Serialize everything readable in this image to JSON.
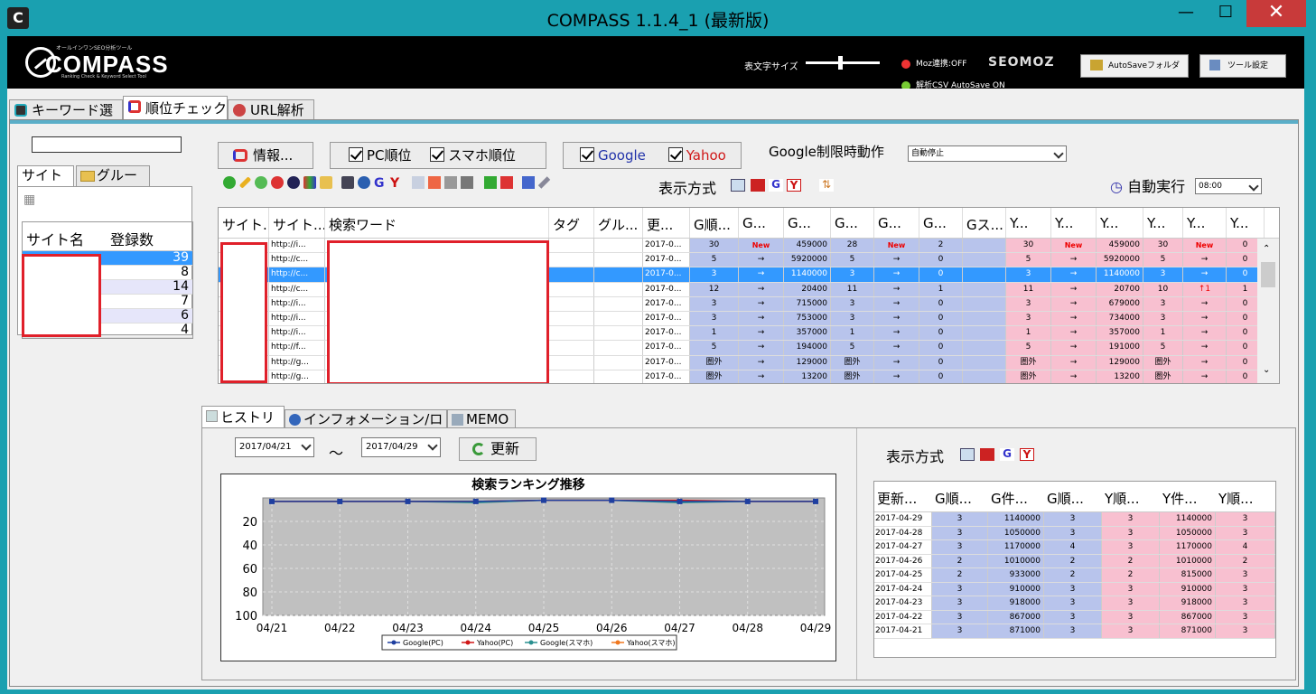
{
  "window": {
    "title": "COMPASS 1.1.4_1 (最新版)",
    "min": "—",
    "max": "☐",
    "close": "✕"
  },
  "header": {
    "logo": "COMPASS",
    "logo_sub": "オールインワンSEO分析ツール",
    "logo_sub2": "Ranking Check & Keyword Select Tool",
    "font_size_label": "表文字サイズ",
    "moz_status": "Moz連携:OFF",
    "csv_status": "解析CSV AutoSave ON",
    "seomoz": "SEOMOZ",
    "autosave_btn": "AutoSaveフォルダ",
    "tool_settings_btn": "ツール設定"
  },
  "main_tabs": [
    "キーワード選定",
    "順位チェック",
    "URL解析"
  ],
  "left": {
    "tabs": [
      "サイト名",
      "グループ"
    ],
    "columns": [
      "サイト名",
      "登録数"
    ],
    "rows": [
      "39",
      "8",
      "14",
      "7",
      "6",
      "4"
    ]
  },
  "toolbar": {
    "info_btn": "情報...",
    "pc_rank": "PC順位",
    "sp_rank": "スマホ順位",
    "google": "Google",
    "yahoo": "Yahoo",
    "google_limit_label": "Google制限時動作",
    "google_limit_value": "自動停止",
    "display_mode": "表示方式",
    "auto_run": "自動実行",
    "auto_run_time": "08:00"
  },
  "table": {
    "columns": [
      "サイト...",
      "サイト...",
      "検索ワード",
      "タグ",
      "グル...",
      "更...",
      "G順...",
      "G...",
      "G...",
      "G...",
      "G...",
      "G...",
      "Gス...",
      "Y...",
      "Y...",
      "Y...",
      "Y...",
      "Y...",
      "Y..."
    ],
    "rows": [
      [
        "http://i...",
        "2017-0...",
        "30",
        "New",
        "459000",
        "28",
        "New",
        "2",
        "30",
        "New",
        "459000",
        "30",
        "New",
        "0"
      ],
      [
        "http://c...",
        "2017-0...",
        "5",
        "→",
        "5920000",
        "5",
        "→",
        "0",
        "5",
        "→",
        "5920000",
        "5",
        "→",
        "0"
      ],
      [
        "http://c...",
        "2017-0...",
        "3",
        "→",
        "1140000",
        "3",
        "→",
        "0",
        "3",
        "→",
        "1140000",
        "3",
        "→",
        "0"
      ],
      [
        "http://c...",
        "2017-0...",
        "12",
        "→",
        "20400",
        "11",
        "→",
        "1",
        "11",
        "→",
        "20700",
        "10",
        "↑1",
        "1"
      ],
      [
        "http://i...",
        "2017-0...",
        "3",
        "→",
        "715000",
        "3",
        "→",
        "0",
        "3",
        "→",
        "679000",
        "3",
        "→",
        "0"
      ],
      [
        "http://i...",
        "2017-0...",
        "3",
        "→",
        "753000",
        "3",
        "→",
        "0",
        "3",
        "→",
        "734000",
        "3",
        "→",
        "0"
      ],
      [
        "http://i...",
        "2017-0...",
        "1",
        "→",
        "357000",
        "1",
        "→",
        "0",
        "1",
        "→",
        "357000",
        "1",
        "→",
        "0"
      ],
      [
        "http://f...",
        "2017-0...",
        "5",
        "→",
        "194000",
        "5",
        "→",
        "0",
        "5",
        "→",
        "191000",
        "5",
        "→",
        "0"
      ],
      [
        "http://g...",
        "2017-0...",
        "圏外",
        "→",
        "129000",
        "圏外",
        "→",
        "0",
        "圏外",
        "→",
        "129000",
        "圏外",
        "→",
        "0"
      ],
      [
        "http://g...",
        "2017-0...",
        "圏外",
        "→",
        "13200",
        "圏外",
        "→",
        "0",
        "圏外",
        "→",
        "13200",
        "圏外",
        "→",
        "0"
      ]
    ],
    "selected_row": 2
  },
  "bottom_tabs": [
    "ヒストリー",
    "インフォメーション/ログ",
    "MEMO"
  ],
  "history": {
    "from": "2017/04/21",
    "tilde": "〜",
    "to": "2017/04/29",
    "refresh": "更新"
  },
  "chart_data": {
    "type": "line",
    "title": "検索ランキング推移",
    "categories": [
      "04/21",
      "04/22",
      "04/23",
      "04/24",
      "04/25",
      "04/26",
      "04/27",
      "04/28",
      "04/29"
    ],
    "yticks": [
      "20",
      "40",
      "60",
      "80",
      "100"
    ],
    "ylim": [
      0,
      100
    ],
    "y_inverted": true,
    "grid": true,
    "legend_position": "bottom",
    "series": [
      {
        "name": "Google(PC)",
        "values": [
          3,
          3,
          3,
          3,
          2,
          2,
          3,
          3,
          3
        ],
        "color": "#1f3fa0"
      },
      {
        "name": "Yahoo(PC)",
        "values": [
          3,
          3,
          3,
          3,
          2,
          2,
          2,
          3,
          3
        ],
        "color": "#d01818"
      },
      {
        "name": "Google(スマホ)",
        "values": [
          3,
          3,
          3,
          4,
          2,
          2,
          4,
          3,
          3
        ],
        "color": "#2a9090"
      },
      {
        "name": "Yahoo(スマホ)",
        "values": [
          3,
          3,
          3,
          3,
          2,
          2,
          3,
          3,
          3
        ],
        "color": "#f07820"
      }
    ]
  },
  "history_table": {
    "display_mode": "表示方式",
    "columns": [
      "更新...",
      "G順...",
      "G件...",
      "G順...",
      "Y順...",
      "Y件...",
      "Y順..."
    ],
    "rows": [
      [
        "2017-04-29",
        "3",
        "1140000",
        "3",
        "3",
        "1140000",
        "3"
      ],
      [
        "2017-04-28",
        "3",
        "1050000",
        "3",
        "3",
        "1050000",
        "3"
      ],
      [
        "2017-04-27",
        "3",
        "1170000",
        "4",
        "3",
        "1170000",
        "4"
      ],
      [
        "2017-04-26",
        "2",
        "1010000",
        "2",
        "2",
        "1010000",
        "2"
      ],
      [
        "2017-04-25",
        "2",
        "933000",
        "2",
        "2",
        "815000",
        "3"
      ],
      [
        "2017-04-24",
        "3",
        "910000",
        "3",
        "3",
        "910000",
        "3"
      ],
      [
        "2017-04-23",
        "3",
        "918000",
        "3",
        "3",
        "918000",
        "3"
      ],
      [
        "2017-04-22",
        "3",
        "867000",
        "3",
        "3",
        "867000",
        "3"
      ],
      [
        "2017-04-21",
        "3",
        "871000",
        "3",
        "3",
        "871000",
        "3"
      ]
    ]
  }
}
